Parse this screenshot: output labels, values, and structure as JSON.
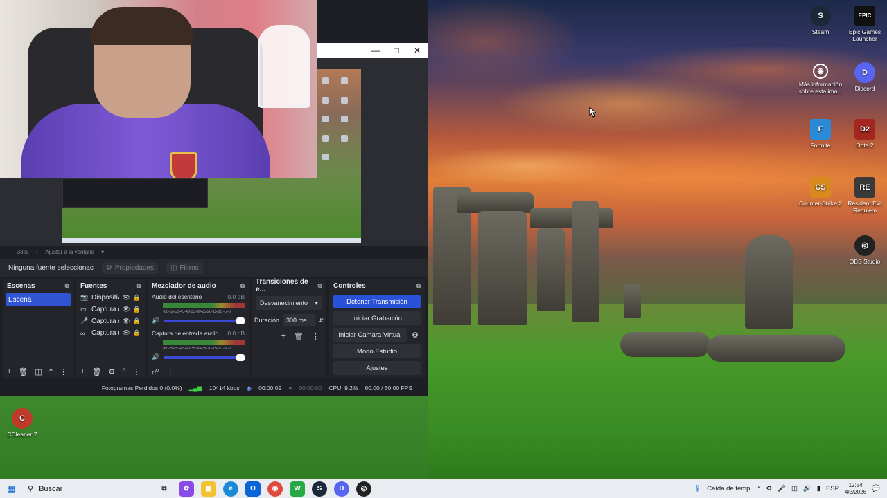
{
  "desktop_icons": [
    {
      "label": "Steam",
      "icon": "steam-icon",
      "color": "#1b2838",
      "glyph": "S"
    },
    {
      "label": "Epic Games Launcher",
      "icon": "epic-games-icon",
      "color": "#111111",
      "glyph": "EPIC"
    },
    {
      "label": "Más información sobre esta ima...",
      "icon": "camera-icon",
      "color": "#2a2a2a",
      "glyph": "◉"
    },
    {
      "label": "Discord",
      "icon": "discord-icon",
      "color": "#5865f2",
      "glyph": "D"
    },
    {
      "label": "Fortnite",
      "icon": "fortnite-icon",
      "color": "#2a8ad8",
      "glyph": "F"
    },
    {
      "label": "Dota 2",
      "icon": "dota2-icon",
      "color": "#a3271f",
      "glyph": "D2"
    },
    {
      "label": "Counter-Strike 2",
      "icon": "counter-strike-icon",
      "color": "#d88a1f",
      "glyph": "CS"
    },
    {
      "label": "Resident Evil Requiem",
      "icon": "resident-evil-icon",
      "color": "#3a3a3a",
      "glyph": "RE"
    },
    {
      "label": "OBS Studio",
      "icon": "obs-icon",
      "color": "#222222",
      "glyph": "◎"
    },
    {
      "label": "CCleaner 7",
      "icon": "ccleaner-icon",
      "color": "#c0392b",
      "glyph": "C"
    }
  ],
  "obs": {
    "zoom": "33%",
    "fit_label": "Ajustar a la ventana",
    "no_source": "Ninguna fuente seleccionac",
    "properties": "Propiedades",
    "filters": "Filtros",
    "docks": {
      "scenes": {
        "title": "Escenas",
        "items": [
          "Escena"
        ]
      },
      "sources": {
        "title": "Fuentes",
        "items": [
          {
            "name": "Dispositiv",
            "icon": "camera-icon"
          },
          {
            "name": "Captura d",
            "icon": "monitor-icon"
          },
          {
            "name": "Captura d",
            "icon": "microphone-icon"
          },
          {
            "name": "Captura d",
            "icon": "link-icon"
          }
        ]
      },
      "mixer": {
        "title": "Mezclador de audio",
        "channels": [
          {
            "name": "Audio del escritorio",
            "db": "0.0 dB",
            "ticks": "-60-55-50-45-40-35-30-25-20-15-10 -5 -0"
          },
          {
            "name": "Captura de entrada audio",
            "db": "0.0 dB",
            "ticks": "-60-55-50-45-40-35-30-25-20-15-10 -5 -0"
          }
        ]
      },
      "transitions": {
        "title": "Transiciones de e...",
        "selected": "Desvanecimiento",
        "duration_label": "Duración",
        "duration": "300 ms"
      },
      "controls": {
        "title": "Controles",
        "stop_stream": "Detener Transmisión",
        "start_record": "Iniciar Grabación",
        "start_virtualcam": "Iniciar Cámara Virtual",
        "studio_mode": "Modo Estudio",
        "settings": "Ajustes"
      }
    },
    "status": {
      "dropped_frames": "Fotogramas Perdidos 0 (0.0%)",
      "bitrate": "10414 kbps",
      "stream_time": "00:00:09",
      "record_time": "00:00:00",
      "cpu": "CPU: 9.2%",
      "fps": "60.00 / 60.00 FPS"
    }
  },
  "taskbar": {
    "search": "Buscar",
    "weather": "Caída de temp.",
    "language": "ESP",
    "time": "12:54",
    "date": "4/3/2026"
  }
}
